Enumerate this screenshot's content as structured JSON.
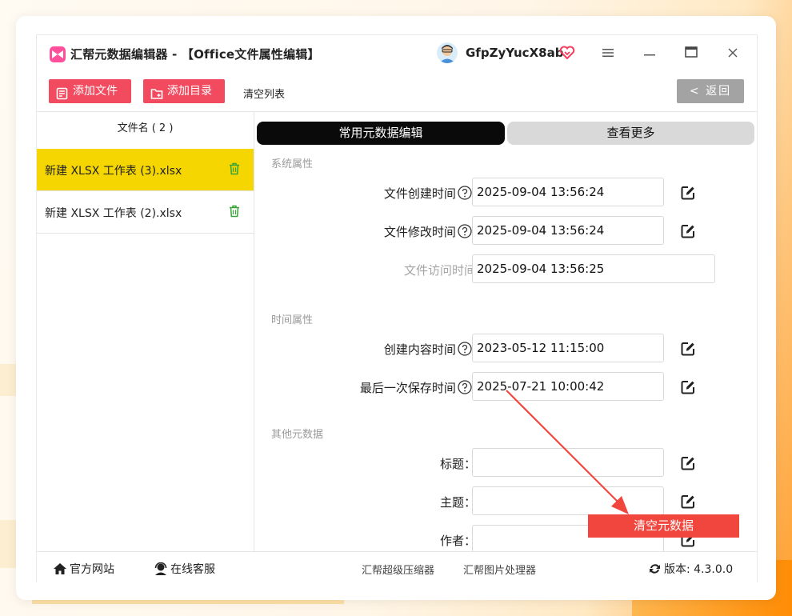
{
  "window": {
    "title": "汇帮元数据编辑器 - 【Office文件属性编辑】",
    "username": "GfpZyYucX8ab"
  },
  "toolbar": {
    "add_file": "添加文件",
    "add_folder": "添加目录",
    "clear_list": "清空列表",
    "back": "< 返回"
  },
  "file_list": {
    "header": "文件名 ( 2 )",
    "items": [
      {
        "name": "新建 XLSX 工作表 (3).xlsx",
        "selected": true
      },
      {
        "name": "新建 XLSX 工作表 (2).xlsx",
        "selected": false
      }
    ]
  },
  "tabs": {
    "common": "常用元数据编辑",
    "more": "查看更多"
  },
  "system_props": {
    "title": "系统属性",
    "created_label": "文件创建时间",
    "created_value": "2025-09-04 13:56:24",
    "modified_label": "文件修改时间",
    "modified_value": "2025-09-04 13:56:24",
    "accessed_label": "文件访问时间",
    "accessed_value": "2025-09-04 13:56:25"
  },
  "time_props": {
    "title": "时间属性",
    "content_created_label": "创建内容时间",
    "content_created_value": "2023-05-12 11:15:00",
    "last_saved_label": "最后一次保存时间",
    "last_saved_value": "2025-07-21 10:00:42"
  },
  "other_props": {
    "title": "其他元数据",
    "title_label": "标题：",
    "title_value": "",
    "subject_label": "主题：",
    "subject_value": "",
    "author_label": "作者：",
    "author_value": ""
  },
  "colon": ":",
  "clear_metadata": "清空元数据",
  "footer": {
    "website": "官方网站",
    "support": "在线客服",
    "compressor": "汇帮超级压缩器",
    "image_tool": "汇帮图片处理器",
    "version": "版本:  4.3.0.0"
  },
  "colors": {
    "accent_red": "#f24b5f",
    "selected_row": "#f5d600",
    "clear_button": "#f0463d"
  }
}
